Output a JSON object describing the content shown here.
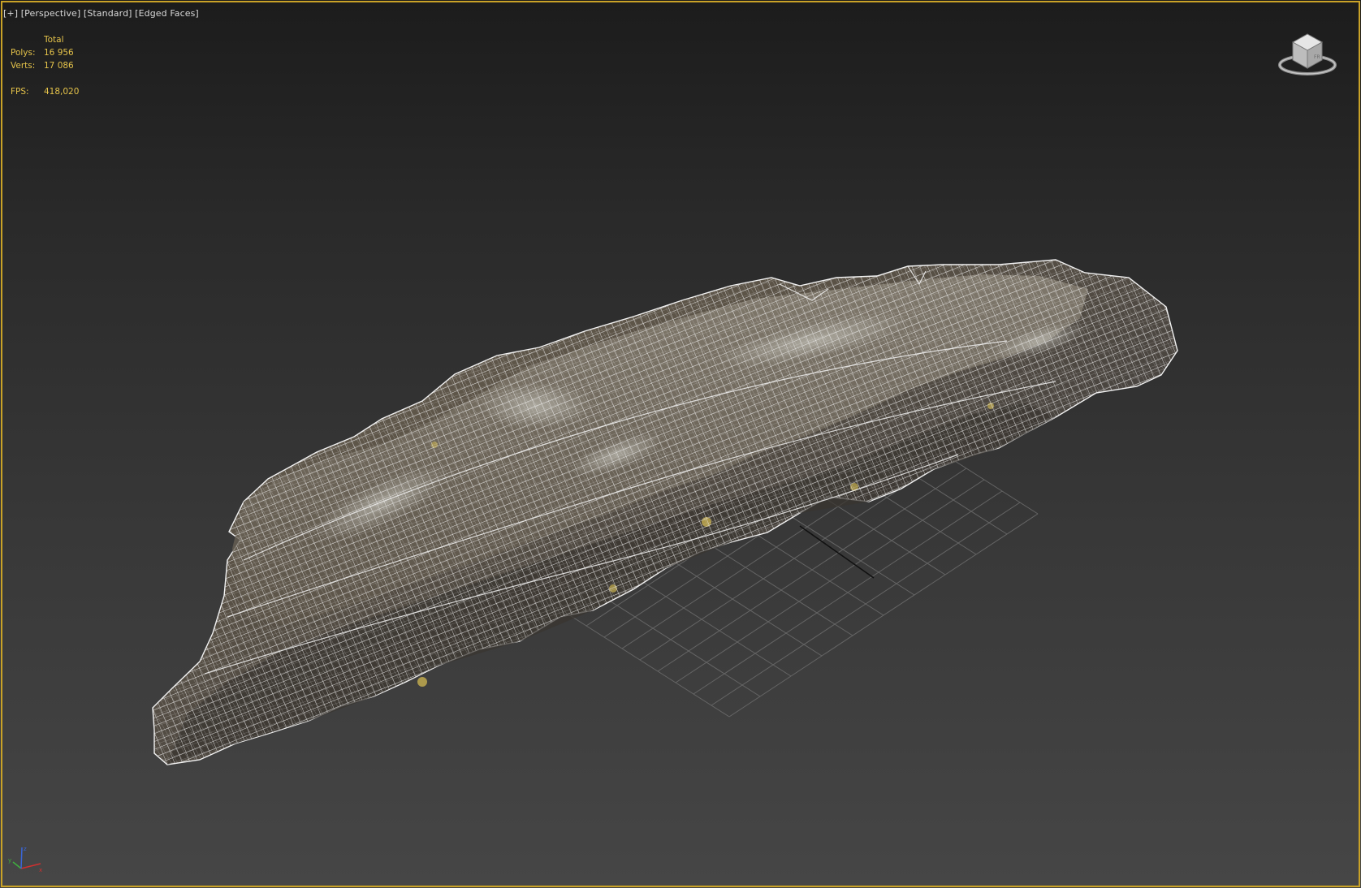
{
  "viewport": {
    "label_plus": "[+]",
    "label_view": "[Perspective]",
    "label_shading": "[Standard]",
    "label_mode": "[Edged Faces]",
    "active_border_color": "#c9a227"
  },
  "stats": {
    "header": "Total",
    "polys_label": "Polys:",
    "polys_value": "16 956",
    "verts_label": "Verts:",
    "verts_value": "17 086",
    "fps_label": "FPS:",
    "fps_value": "418,020",
    "text_color": "#e5c34a"
  },
  "icons": {
    "viewcube": "viewcube-icon",
    "axis_tripod": "axis-tripod-icon"
  },
  "mesh": {
    "wire_color": "#f2f2f2",
    "texture_colors": [
      "#5a5246",
      "#6e6556",
      "#4a4540",
      "#7b7468",
      "#3f3b36"
    ]
  }
}
